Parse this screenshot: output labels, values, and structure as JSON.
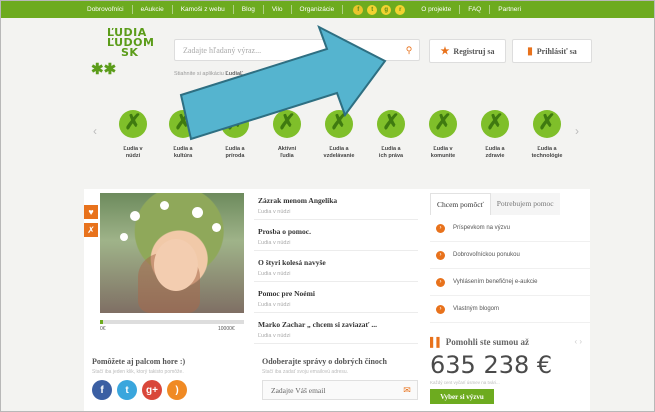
{
  "topnav": {
    "links": [
      "Dobrovoľníci",
      "eAukcie",
      "Kamoši z webu",
      "Blog",
      "Vilo",
      "Organizácie"
    ],
    "social_icons": [
      "facebook-icon",
      "twitter-icon",
      "google-plus-icon",
      "rss-icon"
    ],
    "right_links": [
      "O projekte",
      "FAQ",
      "Partneri"
    ]
  },
  "logo": {
    "lines": [
      "ĽUDIA",
      "ĽUDOM",
      "SK"
    ]
  },
  "search": {
    "placeholder": "Zadajte hľadaný výraz...",
    "icon": "search-icon"
  },
  "apps_text": {
    "prefix": "Stiahnite si aplikáciu",
    "bold": "ĽudiaĽ"
  },
  "register": {
    "label": "Registruj sa",
    "icon": "star-icon"
  },
  "login": {
    "label": "Prihlásiť sa",
    "icon": "login-icon"
  },
  "categories": [
    {
      "line1": "Ľudia v",
      "line2": "núdzi"
    },
    {
      "line1": "Ľudia a",
      "line2": "kultúra"
    },
    {
      "line1": "Ľudia a",
      "line2": "príroda"
    },
    {
      "line1": "Aktívni",
      "line2": "ľudia"
    },
    {
      "line1": "Ľudia a",
      "line2": "vzdelávanie"
    },
    {
      "line1": "Ľudia a",
      "line2": "ich práva"
    },
    {
      "line1": "Ľudia v",
      "line2": "komunite"
    },
    {
      "line1": "Ľudia a",
      "line2": "zdravie"
    },
    {
      "line1": "Ľudia a",
      "line2": "technológie"
    }
  ],
  "featured": {
    "progress_min": "0€",
    "progress_max": "10000€",
    "progress_fraction": 0.02
  },
  "stories": [
    {
      "title": "Zázrak menom Angelika",
      "category": "Ľudia v núdzi"
    },
    {
      "title": "Prosba o pomoc.",
      "category": "Ľudia v núdzi"
    },
    {
      "title": "O štyri kolesá navyše",
      "category": "Ľudia v núdzi"
    },
    {
      "title": "Pomoc pre Noémi",
      "category": "Ľudia v núdzi"
    },
    {
      "title": "Marko Zachar „ chcem si zaviazať ...",
      "category": "Ľudia v núdzi"
    }
  ],
  "help_tabs": [
    "Chcem pomôcť",
    "Potrebujem pomoc"
  ],
  "help_items": [
    "Príspevkom na výzvu",
    "Dobrovoľníckou ponukou",
    "Vyhlásením benefičnej e-aukcie",
    "Vlastným blogom"
  ],
  "total": {
    "heading": "Pomohli ste sumou až",
    "amount": "635 238 €",
    "note": "Každý cent vyčarí úsmev na tvári...",
    "button": "Vyber si výzvu"
  },
  "bottom_left": {
    "title": "Pomôžete aj palcom hore :)",
    "subtitle": "Stačí iba jeden klik, ktorý takisto pomôže."
  },
  "subscribe": {
    "title": "Odoberajte správy o dobrých činoch",
    "subtitle": "Stačí iba zadať svoju emailovú adresu.",
    "placeholder": "Zadajte Váš email"
  },
  "colors": {
    "green": "#6dab1f",
    "orange": "#e8721c",
    "arrow": "#55b4cf"
  }
}
